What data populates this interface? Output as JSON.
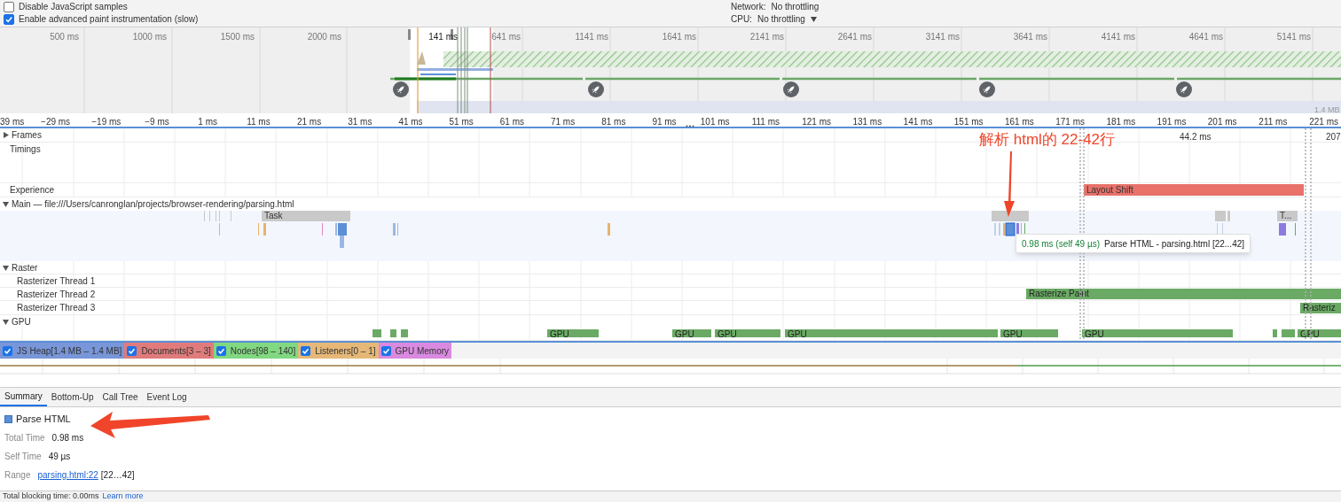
{
  "settings": {
    "checkboxes": [
      {
        "label": "Disable JavaScript samples",
        "checked": false
      },
      {
        "label": "Enable advanced paint instrumentation (slow)",
        "checked": true
      }
    ],
    "network": {
      "label": "Network:",
      "value": "No throttling"
    },
    "cpu": {
      "label": "CPU:",
      "value": "No throttling"
    }
  },
  "overview": {
    "ticks": [
      "500 ms",
      "1000 ms",
      "1500 ms",
      "2000 ms",
      "141 ms",
      "641 ms",
      "1141 ms",
      "1641 ms",
      "2141 ms",
      "2641 ms",
      "3141 ms",
      "3641 ms",
      "4141 ms",
      "4641 ms",
      "5141 ms"
    ],
    "memory_label": "1.4 MB"
  },
  "ruler": {
    "ticks": [
      "39 ms",
      "−29 ms",
      "−19 ms",
      "−9 ms",
      "1 ms",
      "11 ms",
      "21 ms",
      "31 ms",
      "41 ms",
      "51 ms",
      "61 ms",
      "71 ms",
      "81 ms",
      "91 ms",
      "101 ms",
      "111 ms",
      "121 ms",
      "131 ms",
      "141 ms",
      "151 ms",
      "161 ms",
      "171 ms",
      "181 ms",
      "191 ms",
      "201 ms",
      "211 ms",
      "221 ms"
    ]
  },
  "tracks": [
    {
      "label": "Frames",
      "kind": "group",
      "expanded": false,
      "blocks": [
        "44.2 ms",
        "207"
      ]
    },
    {
      "label": "Timings",
      "kind": "plain"
    },
    {
      "label": "Experience",
      "kind": "plain",
      "blocks": [
        "Layout Shift"
      ]
    },
    {
      "label": "Main — file:///Users/canronglan/projects/browser-rendering/parsing.html",
      "kind": "group",
      "expanded": true,
      "blocks": [
        "Task",
        "T..."
      ]
    },
    {
      "label": "Raster",
      "kind": "group",
      "expanded": true
    },
    {
      "label": "Rasterizer Thread 1",
      "kind": "sub"
    },
    {
      "label": "Rasterizer Thread 2",
      "kind": "sub",
      "blocks": [
        "Rasterize Paint"
      ]
    },
    {
      "label": "Rasterizer Thread 3",
      "kind": "sub",
      "blocks": [
        "Rasteriz"
      ]
    },
    {
      "label": "GPU",
      "kind": "group",
      "expanded": true,
      "blocks": [
        "GPU",
        "GPU",
        "GPU",
        "GPU",
        "GPU",
        "GPU",
        "GPU"
      ]
    }
  ],
  "tooltip": {
    "duration": "0.98 ms (self 49 µs)",
    "text": "Parse HTML - parsing.html [22...42]"
  },
  "annotation": {
    "text": "解析 html的 22-42行"
  },
  "counters": [
    {
      "label": "JS Heap[1.4 MB – 1.4 MB]",
      "checked": true,
      "color": "#7896d8"
    },
    {
      "label": "Documents[3 – 3]",
      "checked": true,
      "color": "#e07b7b"
    },
    {
      "label": "Nodes[98 – 140]",
      "checked": true,
      "color": "#80d880"
    },
    {
      "label": "Listeners[0 – 1]",
      "checked": true,
      "color": "#e6b878"
    },
    {
      "label": "GPU Memory",
      "checked": true,
      "color": "#d98ae0"
    }
  ],
  "tabs": [
    {
      "label": "Summary",
      "selected": true
    },
    {
      "label": "Bottom-Up",
      "selected": false
    },
    {
      "label": "Call Tree",
      "selected": false
    },
    {
      "label": "Event Log",
      "selected": false
    }
  ],
  "summary": {
    "title": "Parse HTML",
    "color": "#5b8fd6",
    "rows": [
      {
        "label": "Total Time",
        "value": "0.98 ms"
      },
      {
        "label": "Self Time",
        "value": "49 µs"
      }
    ],
    "range": {
      "label": "Range",
      "link": "parsing.html:22",
      "value": "[22…42]"
    }
  },
  "footer": {
    "text": "Total blocking time: 0.00ms",
    "link": "Learn more"
  }
}
